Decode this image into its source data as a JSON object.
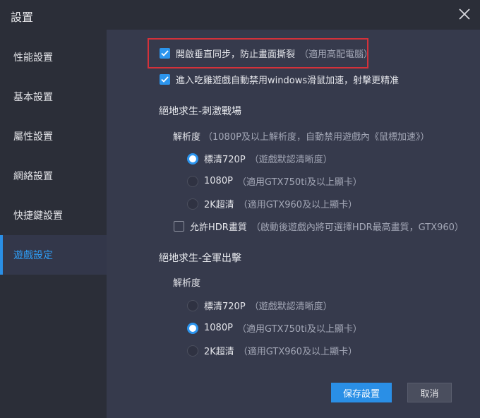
{
  "window": {
    "title": "設置"
  },
  "sidebar": {
    "items": [
      {
        "label": "性能設置",
        "active": false
      },
      {
        "label": "基本設置",
        "active": false
      },
      {
        "label": "屬性設置",
        "active": false
      },
      {
        "label": "網絡設置",
        "active": false
      },
      {
        "label": "快捷鍵設置",
        "active": false
      },
      {
        "label": "遊戲設定",
        "active": true
      }
    ]
  },
  "options": {
    "vsync": {
      "label": "開啟垂直同步，防止畫面撕裂",
      "hint": "（適用高配電腦）",
      "checked": true
    },
    "disable_mouse_accel": {
      "label": "進入吃雞遊戲自動禁用windows滑鼠加速，射擊更精准",
      "checked": true
    }
  },
  "section1": {
    "title": "絕地求生-刺激戰場",
    "resolution_label": "解析度",
    "resolution_hint": "（1080P及以上解析度，自動禁用遊戲內《鼠標加速》）",
    "choices": [
      {
        "label": "標清720P",
        "hint": "（遊戲默認清晰度）",
        "selected": true
      },
      {
        "label": "1080P",
        "hint": "（適用GTX750ti及以上顯卡）",
        "selected": false
      },
      {
        "label": "2K超清",
        "hint": "（適用GTX960及以上顯卡）",
        "selected": false
      }
    ],
    "hdr": {
      "label": "允許HDR畫質",
      "hint": "（啟動後遊戲內將可選擇HDR最高畫質，GTX960）",
      "checked": false
    }
  },
  "section2": {
    "title": "絕地求生-全軍出擊",
    "resolution_label": "解析度",
    "choices": [
      {
        "label": "標清720P",
        "hint": "（遊戲默認清晰度）",
        "selected": false
      },
      {
        "label": "1080P",
        "hint": "（適用GTX750ti及以上顯卡）",
        "selected": true
      },
      {
        "label": "2K超清",
        "hint": "（適用GTX960及以上顯卡）",
        "selected": false
      }
    ]
  },
  "buttons": {
    "save": "保存設置",
    "cancel": "取消"
  },
  "colors": {
    "accent": "#2c95ee",
    "highlight_border": "#d4313a",
    "sidebar_bg": "#2b2e38",
    "panel_bg": "#363a4c"
  }
}
